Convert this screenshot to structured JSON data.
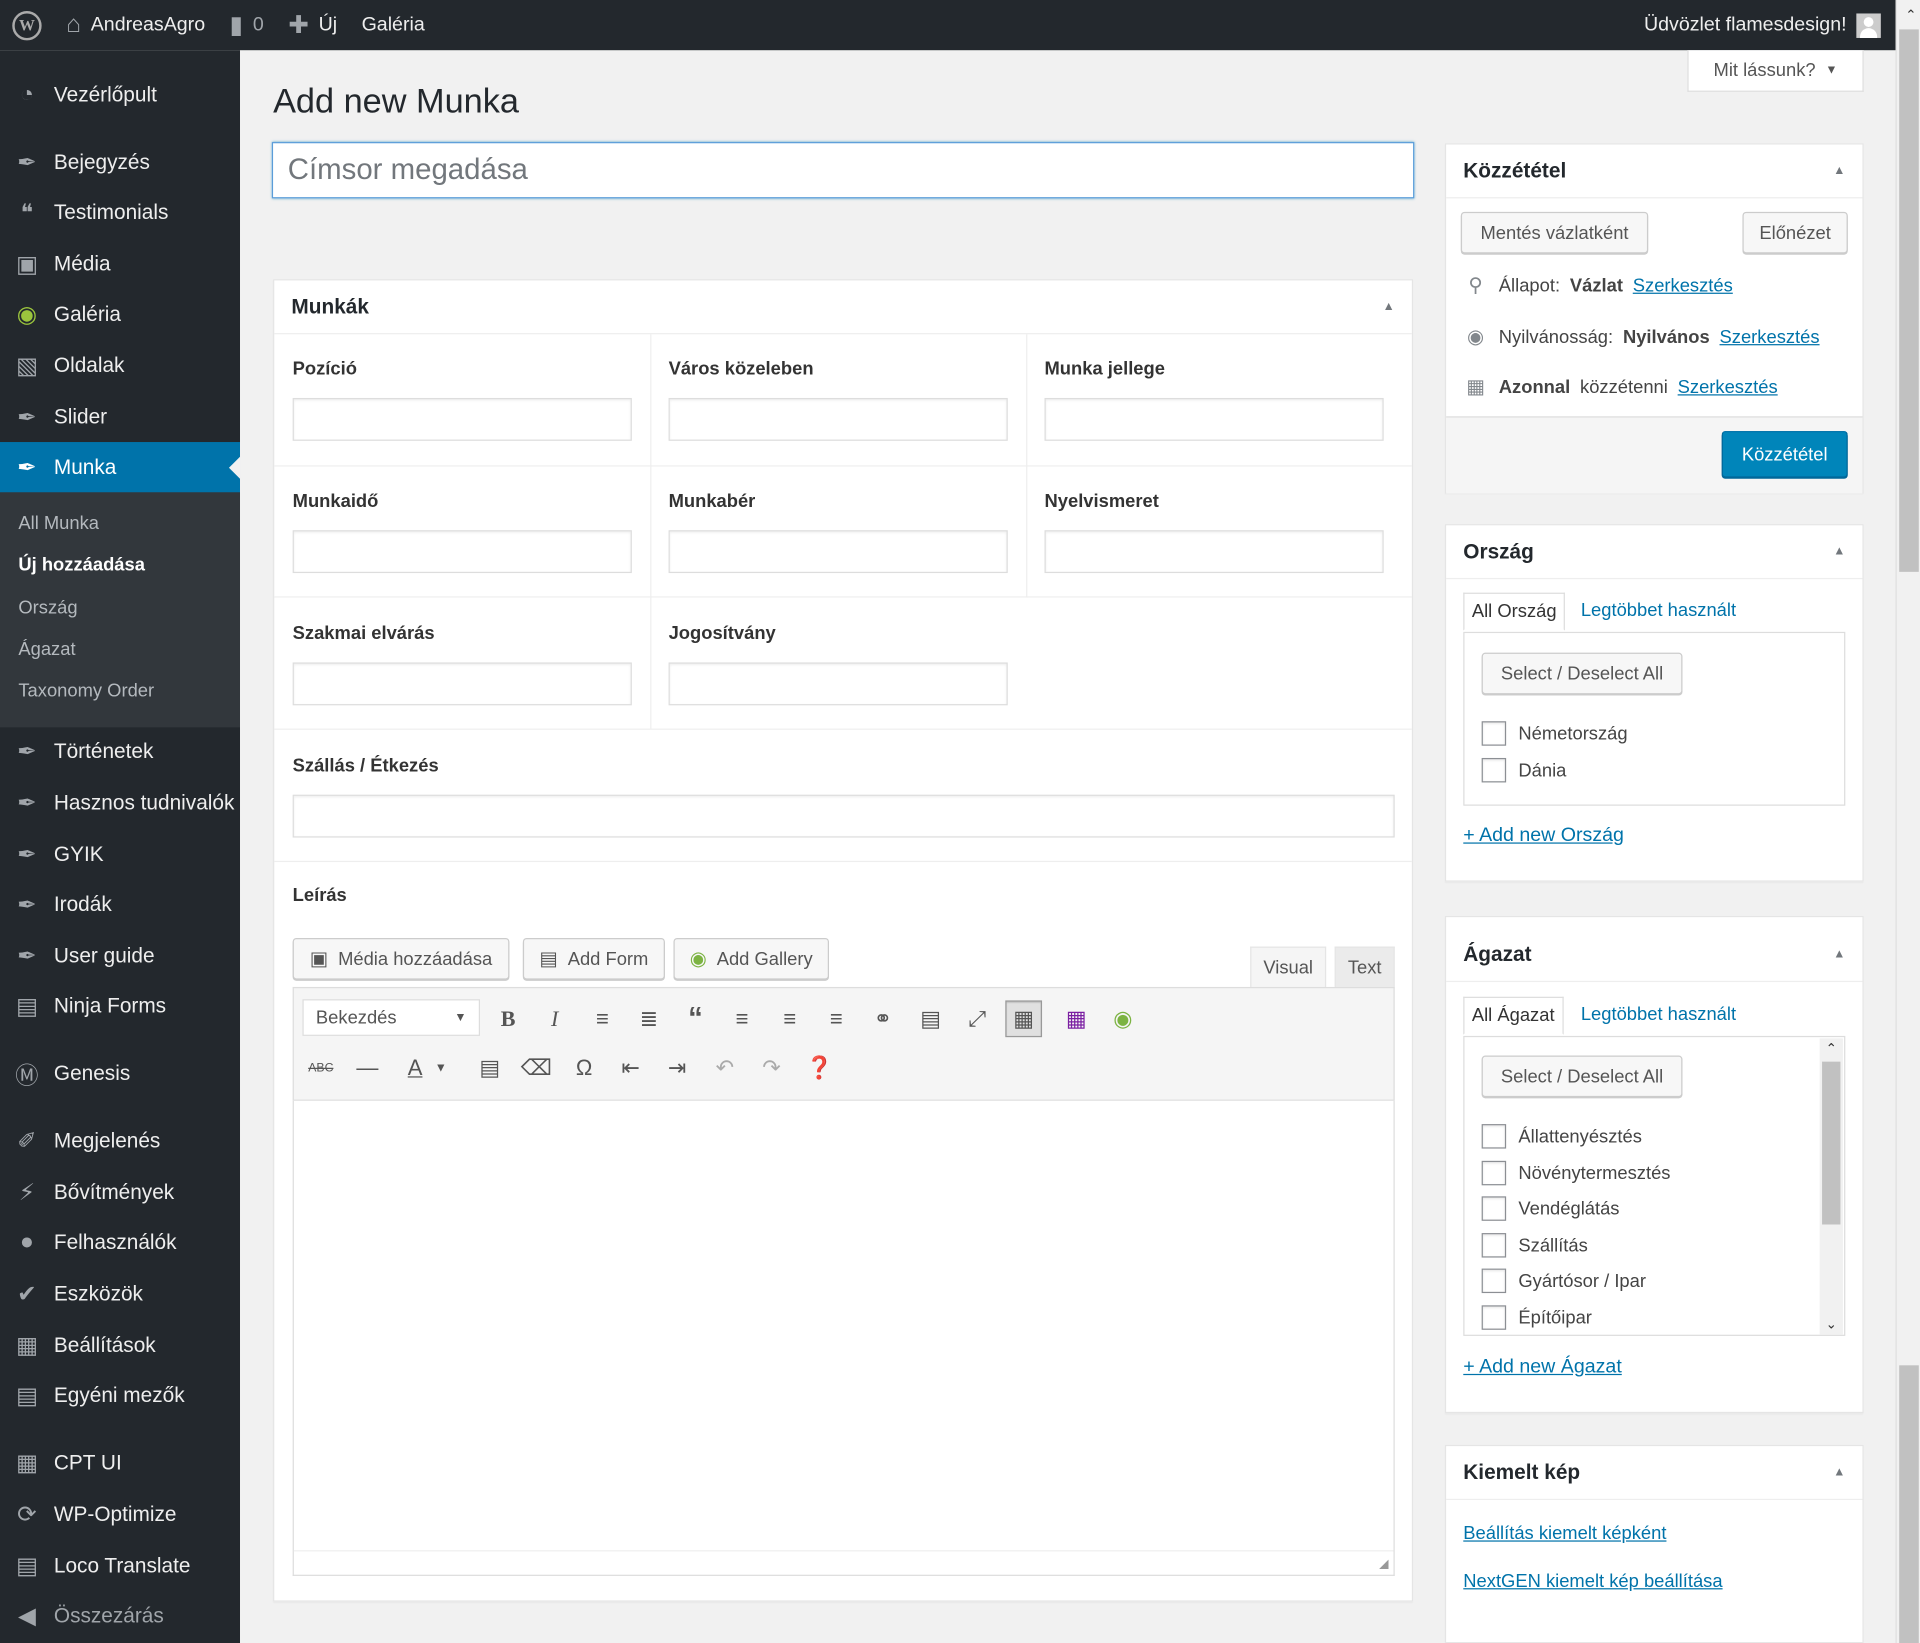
{
  "adminbar": {
    "site_name": "AndreasAgro",
    "comments_count": "0",
    "new_label": "Új",
    "gallery_label": "Galéria",
    "greeting": "Üdvözlet flamesdesign!"
  },
  "sidebar": {
    "items": [
      {
        "label": "Vezérlőpult",
        "icon": "dashboard-icon"
      },
      {
        "label": "Bejegyzés",
        "icon": "pin-icon"
      },
      {
        "label": "Testimonials",
        "icon": "quote-icon"
      },
      {
        "label": "Média",
        "icon": "media-icon"
      },
      {
        "label": "Galéria",
        "icon": "gallery-icon"
      },
      {
        "label": "Oldalak",
        "icon": "pages-icon"
      },
      {
        "label": "Slider",
        "icon": "pin-icon"
      },
      {
        "label": "Munka",
        "icon": "pin-icon"
      },
      {
        "label": "Történetek",
        "icon": "pin-icon"
      },
      {
        "label": "Hasznos tudnivalók",
        "icon": "pin-icon"
      },
      {
        "label": "GYIK",
        "icon": "pin-icon"
      },
      {
        "label": "Irodák",
        "icon": "pin-icon"
      },
      {
        "label": "User guide",
        "icon": "pin-icon"
      },
      {
        "label": "Ninja Forms",
        "icon": "forms-icon"
      },
      {
        "label": "Genesis",
        "icon": "genesis-icon"
      },
      {
        "label": "Megjelenés",
        "icon": "brush-icon"
      },
      {
        "label": "Bővítmények",
        "icon": "plugin-icon"
      },
      {
        "label": "Felhasználók",
        "icon": "user-icon"
      },
      {
        "label": "Eszközök",
        "icon": "wrench-icon"
      },
      {
        "label": "Beállítások",
        "icon": "settings-icon"
      },
      {
        "label": "Egyéni mezők",
        "icon": "fields-icon"
      },
      {
        "label": "CPT UI",
        "icon": "grid-icon"
      },
      {
        "label": "WP-Optimize",
        "icon": "optimize-icon"
      },
      {
        "label": "Loco Translate",
        "icon": "translate-icon"
      },
      {
        "label": "Összezárás",
        "icon": "collapse-icon"
      }
    ],
    "submenu": [
      "All Munka",
      "Új hozzáadása",
      "Ország",
      "Ágazat",
      "Taxonomy Order"
    ]
  },
  "page": {
    "title": "Add new Munka",
    "screen_options": "Mit lássunk?",
    "title_placeholder": "Címsor megadása"
  },
  "munkak": {
    "title": "Munkák",
    "fields": {
      "pozicio": "Pozíció",
      "varos": "Város közeleben",
      "jelleg": "Munka jellege",
      "munkaido": "Munkaidő",
      "munkaber": "Munkabér",
      "nyelv": "Nyelvismeret",
      "szakmai": "Szakmai elvárás",
      "jogositvany": "Jogosítvány",
      "szallas": "Szállás / Étkezés",
      "leiras": "Leírás"
    },
    "buttons": {
      "media": "Média hozzáadása",
      "form": "Add Form",
      "gallery": "Add Gallery"
    },
    "tabs": {
      "visual": "Visual",
      "text": "Text"
    },
    "format_select": "Bekezdés"
  },
  "publish": {
    "title": "Közzététel",
    "save_draft": "Mentés vázlatként",
    "preview": "Előnézet",
    "status_label": "Állapot:",
    "status_value": "Vázlat",
    "visibility_label": "Nyilvánosság:",
    "visibility_value": "Nyilvános",
    "schedule_bold": "Azonnal",
    "schedule_rest": "közzétenni",
    "edit_link": "Szerkesztés",
    "publish_button": "Közzététel"
  },
  "orszag": {
    "title": "Ország",
    "tab_all": "All Ország",
    "tab_popular": "Legtöbbet használt",
    "select_all": "Select / Deselect All",
    "items": [
      "Németország",
      "Dánia"
    ],
    "add_new": "+ Add new Ország"
  },
  "agazat": {
    "title": "Ágazat",
    "tab_all": "All Ágazat",
    "tab_popular": "Legtöbbet használt",
    "select_all": "Select / Deselect All",
    "items": [
      "Állattenyésztés",
      "Növénytermesztés",
      "Vendéglátás",
      "Szállítás",
      "Gyártósor / Ipar",
      "Építőipar"
    ],
    "add_new": "+ Add new Ágazat"
  },
  "kiemelt": {
    "title": "Kiemelt kép",
    "link1": "Beállítás kiemelt képként",
    "link2": "NextGEN kiemelt kép beállítása"
  }
}
